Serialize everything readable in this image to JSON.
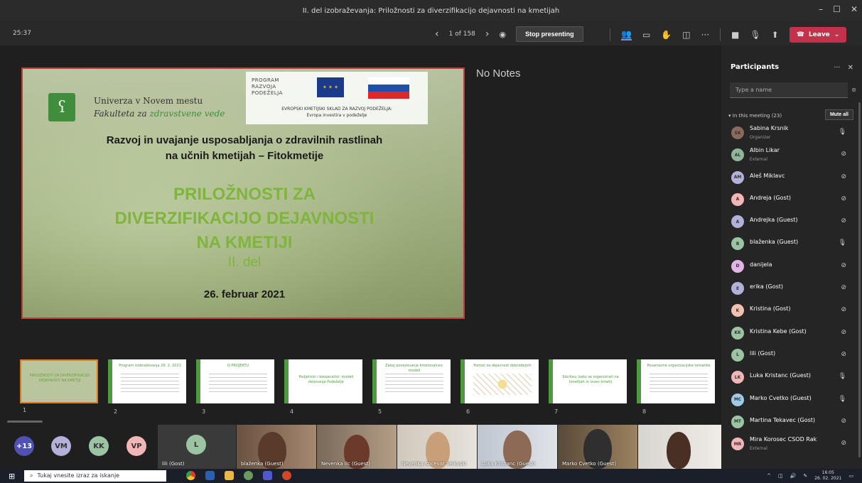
{
  "window": {
    "title": "II. del izobraževanja: Priložnosti za diverzifikacijo dejavnosti na kmetijah"
  },
  "toolbar": {
    "timer": "25:37",
    "page_indicator": "1 of 158",
    "stop_label": "Stop presenting",
    "leave_label": "Leave"
  },
  "slide": {
    "uni_line1": "Univerza v Novem mestu",
    "uni_line2a": "Fakulteta za ",
    "uni_line2b": "zdravstvene vede",
    "program_logo": [
      "PROGRAM",
      "RAZVOJA",
      "PODEŽELJA"
    ],
    "program_caption1": "EVROPSKI KMETIJSKI SKLAD ZA RAZVOJ PODEŽELJA:",
    "program_caption2": "Evropa investira v podeželje",
    "subtitle1": "Razvoj in uvajanje usposabljanja o zdravilnih rastlinah",
    "subtitle2": "na učnih kmetijah – Fitokmetije",
    "title1": "PRILOŽNOSTI ZA",
    "title2": "DIVERZIFIKACIJO DEJAVNOSTI",
    "title3": "NA KMETIJI",
    "part": "II. del",
    "date": "26. februar 2021"
  },
  "notes": "No Notes",
  "thumbnails": [
    {
      "num": "1",
      "title": "PRILOŽNOSTI ZA DIVERZIFIKACIJO DEJAVNOSTI NA KMETIJI"
    },
    {
      "num": "2",
      "title": "Program izobraževanja 26. 2. 2021"
    },
    {
      "num": "3",
      "title": "O PROJEKTU"
    },
    {
      "num": "4",
      "title": "Podjetniki i kooperativi: modeli delovanja Podeželje"
    },
    {
      "num": "5",
      "title": "Zakaj povezovanje kmetovalcev: modeli"
    },
    {
      "num": "6",
      "title": "Pomoč za dejavnost dobrodejnih"
    },
    {
      "num": "7",
      "title": "Storitev, kako se organizirati na kmetijah in izven kmetij"
    },
    {
      "num": "8",
      "title": "Posamezne organizacijske tematike"
    }
  ],
  "gallery": {
    "overflow": "+13",
    "avatars": [
      "VM",
      "KK",
      "VP"
    ],
    "self": {
      "initial": "L",
      "label": "lili (Gost)"
    },
    "tiles": [
      "blaženka (Guest)",
      "Nevenka Ilc (Guest)",
      "Nevenka Kocevar Velkoski",
      "Luka Kristanc (Guest)",
      "Marko Cvetko (Guest)",
      ""
    ]
  },
  "participants": {
    "title": "Participants",
    "search_placeholder": "Type a name",
    "meeting_header": "In this meeting (23)",
    "mute_all_label": "Mute all",
    "list": [
      {
        "initials": "SK",
        "name": "Sabina Krsnik",
        "sub": "Organizer",
        "color": "#8a6a5a",
        "mic": "on"
      },
      {
        "initials": "AL",
        "name": "Albin Likar",
        "sub": "External",
        "color": "#8fb59a",
        "mic": "off"
      },
      {
        "initials": "AM",
        "name": "Aleš Miklavc",
        "sub": "",
        "color": "#b3b0da",
        "mic": "off"
      },
      {
        "initials": "A",
        "name": "Andreja (Gost)",
        "sub": "",
        "color": "#f2b6b6",
        "mic": "off"
      },
      {
        "initials": "A",
        "name": "Andrejka (Guest)",
        "sub": "",
        "color": "#b3b0da",
        "mic": "off"
      },
      {
        "initials": "B",
        "name": "blaženka (Guest)",
        "sub": "",
        "color": "#9bc4a3",
        "mic": "on"
      },
      {
        "initials": "D",
        "name": "danijela",
        "sub": "",
        "color": "#e3b4e6",
        "mic": "off"
      },
      {
        "initials": "E",
        "name": "erika (Gost)",
        "sub": "",
        "color": "#b3b0da",
        "mic": "off"
      },
      {
        "initials": "K",
        "name": "Kristina (Gost)",
        "sub": "",
        "color": "#f2c2b0",
        "mic": "off"
      },
      {
        "initials": "KK",
        "name": "Kristina Kebe (Gost)",
        "sub": "",
        "color": "#9bc4a3",
        "mic": "off"
      },
      {
        "initials": "L",
        "name": "lili (Gost)",
        "sub": "",
        "color": "#9bc4a3",
        "mic": "off"
      },
      {
        "initials": "LK",
        "name": "Luka Kristanc (Guest)",
        "sub": "",
        "color": "#f2b6b6",
        "mic": "on"
      },
      {
        "initials": "MC",
        "name": "Marko Cvetko (Guest)",
        "sub": "",
        "color": "#9ecae8",
        "mic": "on"
      },
      {
        "initials": "MT",
        "name": "Martina Tekavec (Gost)",
        "sub": "",
        "color": "#9bc4a3",
        "mic": "off"
      },
      {
        "initials": "MR",
        "name": "Mira Korosec CSOD Rak",
        "sub": "External",
        "color": "#f2b6b6",
        "mic": "off"
      }
    ]
  },
  "taskbar": {
    "search_placeholder": "Tukaj vnesite izraz za iskanje",
    "time": "16:05",
    "date": "26. 02. 2021"
  },
  "colors": {
    "leave": "#c4314b",
    "accent": "#7fb43d",
    "slide_border": "#c23c3c"
  }
}
